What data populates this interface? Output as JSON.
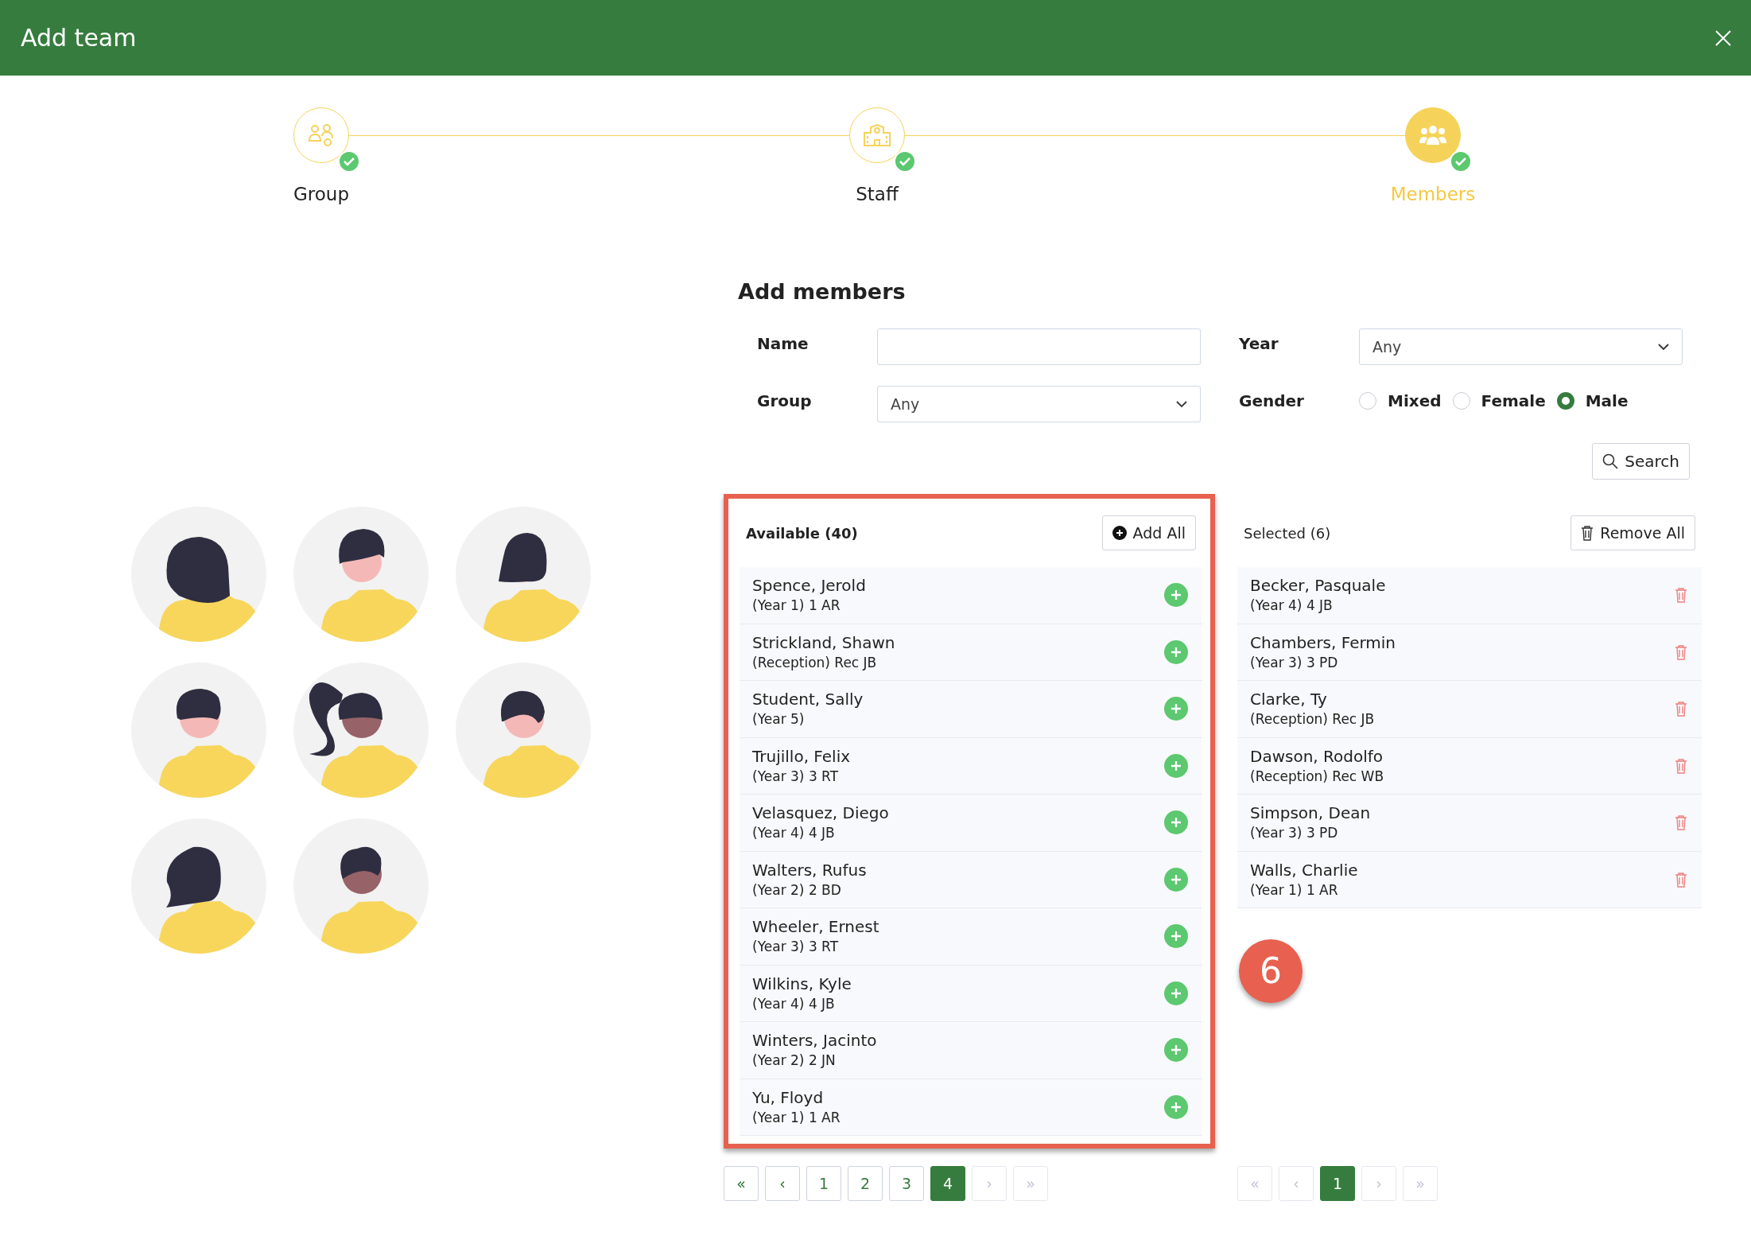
{
  "dialog": {
    "title": "Add team"
  },
  "steps": [
    {
      "label": "Group",
      "completed": true,
      "selected": false
    },
    {
      "label": "Staff",
      "completed": true,
      "selected": false
    },
    {
      "label": "Members",
      "completed": true,
      "selected": true
    }
  ],
  "form": {
    "heading": "Add members",
    "fields": [
      {
        "kind": "text",
        "label": "Name"
      },
      {
        "kind": "select",
        "label": "Year",
        "value": "Any"
      },
      {
        "kind": "select",
        "label": "Group",
        "value": "Any"
      },
      {
        "kind": "radio",
        "label": "Gender",
        "options": [
          {
            "label": "Mixed",
            "selected": false
          },
          {
            "label": "Female",
            "selected": false
          },
          {
            "label": "Male",
            "selected": true
          }
        ]
      }
    ],
    "search_button": "Search"
  },
  "available": {
    "title": "Available (40)",
    "action": "Add All",
    "rows": [
      {
        "name": "Spence, Jerold",
        "detail": "(Year 1) 1 AR"
      },
      {
        "name": "Strickland, Shawn",
        "detail": "(Reception) Rec JB"
      },
      {
        "name": "Student, Sally",
        "detail": "(Year 5)"
      },
      {
        "name": "Trujillo, Felix",
        "detail": "(Year 3) 3 RT"
      },
      {
        "name": "Velasquez, Diego",
        "detail": "(Year 4) 4 JB"
      },
      {
        "name": "Walters, Rufus",
        "detail": "(Year 2) 2 BD"
      },
      {
        "name": "Wheeler, Ernest",
        "detail": "(Year 3) 3 RT"
      },
      {
        "name": "Wilkins, Kyle",
        "detail": "(Year 4) 4 JB"
      },
      {
        "name": "Winters, Jacinto",
        "detail": "(Year 2) 2 JN"
      },
      {
        "name": "Yu, Floyd",
        "detail": "(Year 1) 1 AR"
      }
    ],
    "pagination": [
      {
        "label": "«",
        "selected": false,
        "disabled": false
      },
      {
        "label": "‹",
        "selected": false,
        "disabled": false
      },
      {
        "label": "1",
        "selected": false,
        "disabled": false
      },
      {
        "label": "2",
        "selected": false,
        "disabled": false
      },
      {
        "label": "3",
        "selected": false,
        "disabled": false
      },
      {
        "label": "4",
        "selected": true,
        "disabled": false
      },
      {
        "label": "›",
        "selected": false,
        "disabled": true
      },
      {
        "label": "»",
        "selected": false,
        "disabled": true
      }
    ]
  },
  "selected": {
    "title": "Selected (6)",
    "action": "Remove All",
    "rows": [
      {
        "name": "Becker, Pasquale",
        "detail": "(Year 4) 4 JB"
      },
      {
        "name": "Chambers, Fermin",
        "detail": "(Year 3) 3 PD"
      },
      {
        "name": "Clarke, Ty",
        "detail": "(Reception) Rec JB"
      },
      {
        "name": "Dawson, Rodolfo",
        "detail": "(Reception) Rec WB"
      },
      {
        "name": "Simpson, Dean",
        "detail": "(Year 3) 3 PD"
      },
      {
        "name": "Walls, Charlie",
        "detail": "(Year 1) 1 AR"
      }
    ],
    "pagination": [
      {
        "label": "«",
        "selected": false,
        "disabled": true
      },
      {
        "label": "‹",
        "selected": false,
        "disabled": true
      },
      {
        "label": "1",
        "selected": true,
        "disabled": false
      },
      {
        "label": "›",
        "selected": false,
        "disabled": true
      },
      {
        "label": "»",
        "selected": false,
        "disabled": true
      }
    ]
  },
  "annotation": {
    "badge": "6"
  }
}
